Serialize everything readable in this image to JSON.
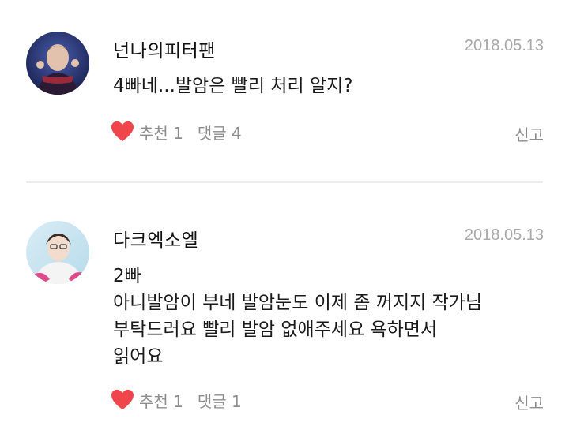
{
  "comments": [
    {
      "author": "넌나의피터팬",
      "date": "2018.05.13",
      "lines": [
        "4빠네...발암은 빨리 처리 알지?"
      ],
      "like_label": "추천 1",
      "reply_label": "댓글 4",
      "report_label": "신고"
    },
    {
      "author": "다크엑소엘",
      "date": "2018.05.13",
      "lines": [
        "2빠",
        "아니발암이 부네 발암눈도 이제 좀 꺼지지 작가님",
        "부탁드러요 빨리 발암 없애주세요 욕하면서",
        "읽어요"
      ],
      "like_label": "추천 1",
      "reply_label": "댓글 1",
      "report_label": "신고"
    }
  ],
  "colors": {
    "heart": "#f0464b",
    "date": "#a8a8a8",
    "action": "#8d8d8d",
    "divider": "#ececec"
  }
}
